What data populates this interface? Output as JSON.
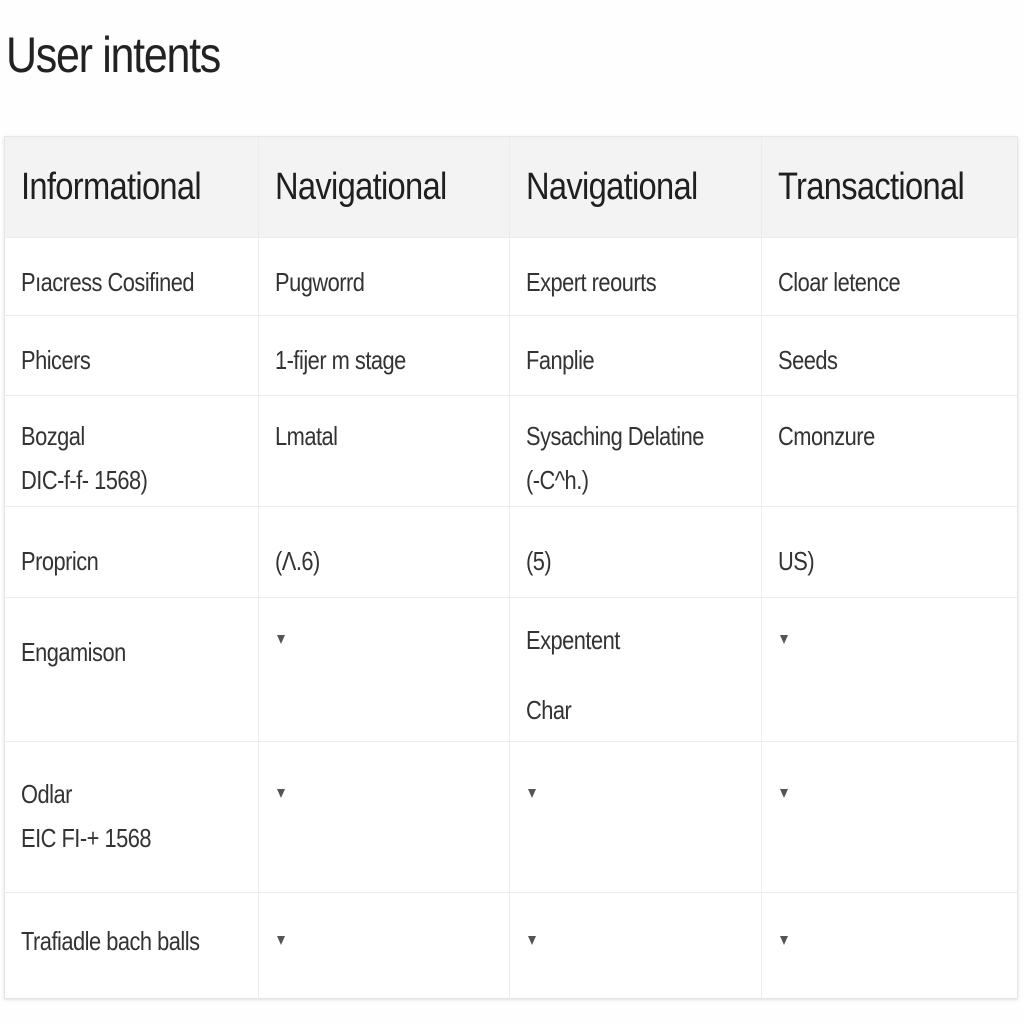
{
  "title": "User intents",
  "table": {
    "headers": [
      "Informational",
      "Navigational",
      "Navigational",
      "Transactional"
    ],
    "rows": [
      {
        "cells": [
          {
            "lines": [
              "Pıacress Cosifined"
            ]
          },
          {
            "lines": [
              "Pugworrd"
            ]
          },
          {
            "lines": [
              "Expert reourts"
            ]
          },
          {
            "lines": [
              "Cloar letence"
            ]
          }
        ]
      },
      {
        "cells": [
          {
            "lines": [
              "Phicers"
            ]
          },
          {
            "lines": [
              "1-fijer m stage"
            ]
          },
          {
            "lines": [
              "Fanplie"
            ]
          },
          {
            "lines": [
              "Seeds"
            ]
          }
        ]
      },
      {
        "cells": [
          {
            "lines": [
              "Bozgal",
              "DIC-f-f- 1568)"
            ]
          },
          {
            "lines": [
              "Lmatal"
            ]
          },
          {
            "lines": [
              "Sysaching Delatine",
              "(-C^h.)"
            ]
          },
          {
            "lines": [
              "Cmonzure"
            ]
          }
        ]
      },
      {
        "cells": [
          {
            "lines": [
              "Propricn"
            ]
          },
          {
            "lines": [
              "(Λ.6)"
            ]
          },
          {
            "lines": [
              "(5)"
            ]
          },
          {
            "lines": [
              "US)"
            ]
          }
        ]
      },
      {
        "cells": [
          {
            "lines": [
              "Engamison"
            ]
          },
          {
            "dropdown": "caret-down-icon"
          },
          {
            "lines": [
              "Expentent",
              "Char"
            ]
          },
          {
            "dropdown": "caret-down-icon"
          }
        ]
      },
      {
        "cells": [
          {
            "lines": [
              "Odlar",
              "EIC FI-+ 1568"
            ]
          },
          {
            "dropdown": "caret-down-icon"
          },
          {
            "dropdown": "caret-down-icon"
          },
          {
            "dropdown": "caret-down-icon"
          }
        ]
      },
      {
        "cells": [
          {
            "lines": [
              "Trafiadle bach balls"
            ]
          },
          {
            "dropdown": "caret-down-icon"
          },
          {
            "dropdown": "caret-down-icon"
          },
          {
            "dropdown": "caret-down-icon"
          }
        ]
      }
    ]
  }
}
